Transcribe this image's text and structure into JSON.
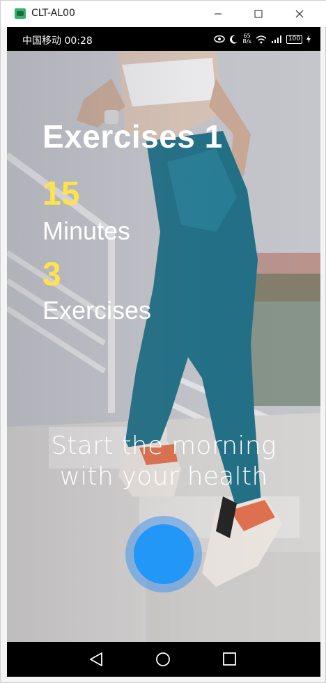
{
  "window": {
    "title": "CLT-AL00"
  },
  "status_bar": {
    "carrier_time": "中国移动 00:28",
    "net_speed_value": "65",
    "net_speed_unit": "B/s",
    "battery": "100",
    "icons": [
      "eye-icon",
      "moon-icon",
      "wifi-icon",
      "signal-icon",
      "battery-icon",
      "charging-icon"
    ]
  },
  "screen": {
    "title": "Exercises 1",
    "minutes_value": "15",
    "minutes_label": "Minutes",
    "exercises_value": "3",
    "exercises_label": "Exercises",
    "tagline_line1": "Start the morning",
    "tagline_line2": "with your health"
  },
  "colors": {
    "accent_yellow": "#ffe34d",
    "button_blue": "#2297f7",
    "leggings_teal": "#1f6f86"
  },
  "nav_bar": {
    "icons": [
      "back-icon",
      "home-icon",
      "recent-apps-icon"
    ]
  }
}
